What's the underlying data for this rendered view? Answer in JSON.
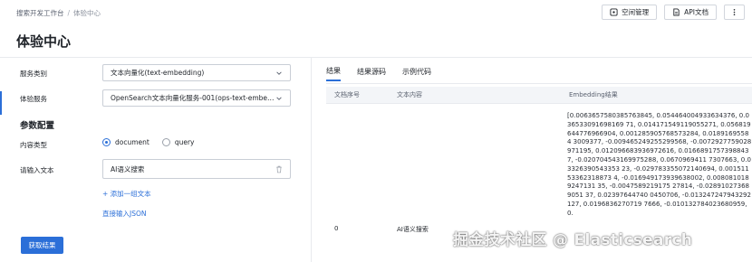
{
  "breadcrumb": {
    "parent": "搜索开发工作台",
    "separator": "/",
    "current": "体验中心"
  },
  "top_actions": {
    "space_mgmt": "空间管理",
    "api_docs": "API文档",
    "more": ""
  },
  "page_title": "体验中心",
  "form": {
    "service_type_label": "服务类别",
    "service_type_value": "文本向量化(text-embedding)",
    "exp_service_label": "体验服务",
    "exp_service_value": "OpenSearch文本向量化服务-001(ops-text-embeddin...",
    "params_title": "参数配置",
    "content_type_label": "内容类型",
    "content_type_options": [
      "document",
      "query"
    ],
    "content_type_selected": "document",
    "input_text_label": "请输入文本",
    "input_text_value": "AI语义搜索",
    "add_group_link": "+ 添加一组文本",
    "json_input_link": "直接输入JSON",
    "submit_button": "获取结果"
  },
  "result_panel": {
    "tabs": [
      "结果",
      "结果源码",
      "示例代码"
    ],
    "active_tab": "结果",
    "columns": [
      "文档序号",
      "文本内容",
      "Embedding结果"
    ],
    "row": {
      "index": "0",
      "text": "AI语义搜索",
      "embedding": "[0.0063657580385763845, 0.054464004933634376, 0.036533091698169 71, 0.014171549119055271, 0.056819644776966904, 0.001285905768573284, 0.01891695584 3009377, -0.009465249255299568, -0.0072927759028971195, 0.012096683936972616, 0.01668917573988437, -0.020704543169975288, 0.0670969411 7307663, 0.03326390543353 23, -0.029783355072140694, 0.00151153362318873 4, -0.016949173939638002, 0.0080810189247131 35, -0.0047589219175 27814, -0.028910273689051 37, 0.02397644740 0450706, -0.013247247943292127, 0.0196836270719 7666, -0.010132784023680959, 0."
    }
  },
  "watermark": "掘金技术社区 @ Elasticsearch"
}
